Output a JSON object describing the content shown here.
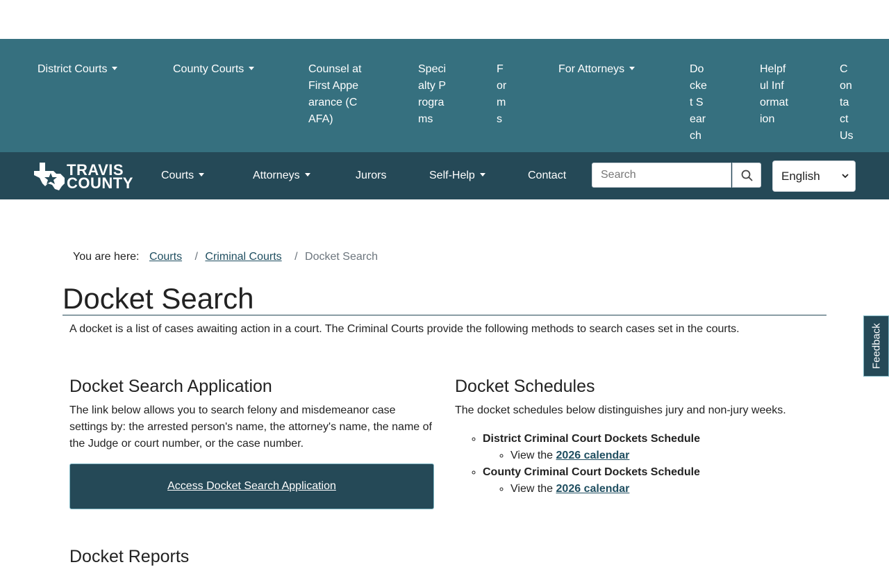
{
  "subnav": {
    "district": "District Courts",
    "county": "County Courts",
    "cafa": "Counsel at First Appearance (CAFA)",
    "specialty": "Specialty Programs",
    "forms": "Forms",
    "attorneys": "For Attorneys",
    "docket": "Docket Search",
    "helpful": "Helpful Information",
    "contact": "Contact Us"
  },
  "logo": {
    "line1": "TRAVIS",
    "line2": "COUNTY"
  },
  "mainnav": {
    "courts": "Courts",
    "attorneys": "Attorneys",
    "jurors": "Jurors",
    "selfhelp": "Self-Help",
    "contact": "Contact"
  },
  "search": {
    "placeholder": "Search"
  },
  "language": {
    "selected": "English"
  },
  "breadcrumb": {
    "label": "You are here:",
    "items": [
      "Courts",
      "Criminal Courts"
    ],
    "current": "Docket Search",
    "sep": "/"
  },
  "page": {
    "title": "Docket Search",
    "intro": "A docket is a list of cases awaiting action in a court. The Criminal Courts provide the following methods to search cases set in the courts."
  },
  "app": {
    "heading": "Docket Search Application",
    "text": "The link below allows you to search felony and misdemeanor case settings by: the arrested person's name, the attorney's name, the name of the Judge or court number, or the case number.",
    "button": "Access Docket Search Application"
  },
  "schedules": {
    "heading": "Docket Schedules",
    "text": "The docket schedules below distinguishes jury and non-jury weeks.",
    "district": "District Criminal Court Dockets Schedule",
    "county": "County Criminal Court Dockets Schedule",
    "view_prefix": "View the",
    "link": "2026 calendar"
  },
  "feedback": "Feedback",
  "next_heading": "Docket Reports",
  "colors": {
    "subnav_bg": "#36707f",
    "mainnav_bg": "#254957",
    "link": "#1f4e60"
  }
}
